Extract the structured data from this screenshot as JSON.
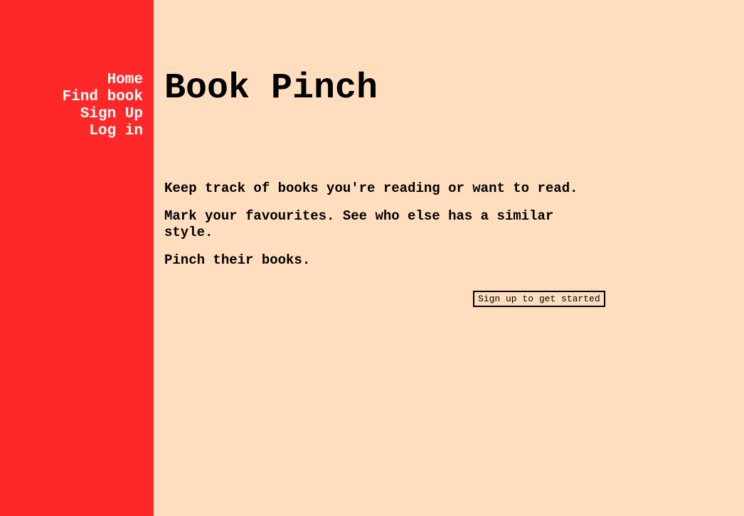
{
  "colors": {
    "sidebar_background": "#FE2828",
    "page_background": "#FFDEBF",
    "nav_text": "#FFFFFF",
    "body_text": "#000000"
  },
  "nav": {
    "items": [
      {
        "label": "Home"
      },
      {
        "label": "Find book"
      },
      {
        "label": "Sign Up"
      },
      {
        "label": "Log in"
      }
    ]
  },
  "header": {
    "title": "Book Pinch"
  },
  "main": {
    "paragraphs": [
      "Keep track of books you're reading or want to read.",
      "Mark your favourites. See who else has a similar style.",
      "Pinch their books."
    ],
    "cta_label": "Sign up to get started"
  }
}
